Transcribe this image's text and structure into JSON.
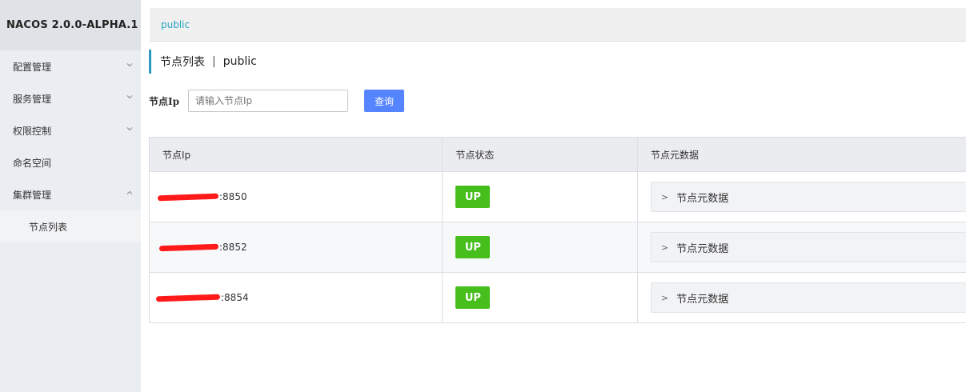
{
  "app": {
    "title": "NACOS 2.0.0-ALPHA.1"
  },
  "sidebar": {
    "items": [
      {
        "label": "配置管理",
        "expanded": false
      },
      {
        "label": "服务管理",
        "expanded": false
      },
      {
        "label": "权限控制",
        "expanded": false
      },
      {
        "label": "命名空间"
      },
      {
        "label": "集群管理",
        "expanded": true
      }
    ],
    "subitems": [
      {
        "label": "节点列表"
      }
    ]
  },
  "namespace_bar": {
    "current": "public"
  },
  "page": {
    "title": "节点列表",
    "separator": "|",
    "namespace": "public"
  },
  "search": {
    "label": "节点Ip",
    "placeholder": "请输入节点Ip",
    "button": "查询"
  },
  "table": {
    "headers": [
      "节点Ip",
      "节点状态",
      "节点元数据"
    ],
    "rows": [
      {
        "ip_suffix": ":8850",
        "status": "UP",
        "metadata_label": "节点元数据"
      },
      {
        "ip_suffix": ":8852",
        "status": "UP",
        "metadata_label": "节点元数据"
      },
      {
        "ip_suffix": ":8854",
        "status": "UP",
        "metadata_label": "节点元数据"
      }
    ]
  },
  "colors": {
    "status_up": "#46be1b",
    "primary_button": "#5584ff",
    "accent": "#2e9ac1",
    "redaction": "#ff1a1a"
  },
  "icons": {
    "collapse": "chevron-down-icon",
    "expand": "chevron-up-icon",
    "metadata_toggle": "chevron-right-icon"
  }
}
